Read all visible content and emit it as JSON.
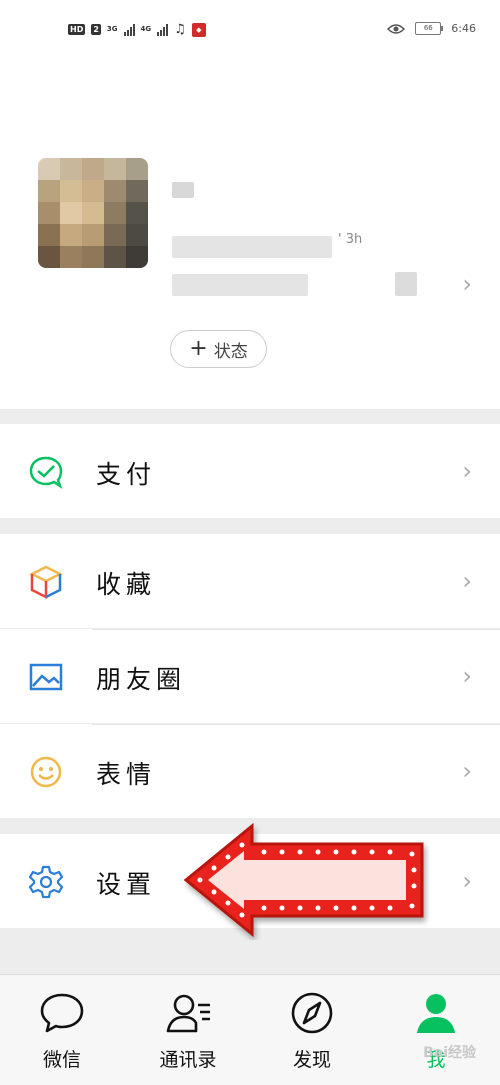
{
  "status_bar": {
    "left_badges": [
      "HD",
      "2"
    ],
    "networks": [
      "3G",
      "4G"
    ],
    "time": "6:46",
    "battery": "66"
  },
  "profile": {
    "id_fragment": "' 3h",
    "status_button": "状态",
    "status_plus": "+"
  },
  "menu": {
    "pay": "支付",
    "favorites": "收藏",
    "moments": "朋友圈",
    "stickers": "表情",
    "settings": "设置"
  },
  "tabs": [
    {
      "label": "微信",
      "icon": "chat-bubble-icon"
    },
    {
      "label": "通讯录",
      "icon": "contacts-icon"
    },
    {
      "label": "发现",
      "icon": "compass-icon"
    },
    {
      "label": "我",
      "icon": "person-icon"
    }
  ],
  "watermark": "Bai经验",
  "colors": {
    "accent": "#07c160",
    "settings_icon": "#2b7fd6",
    "moments_icon": "#2b7fd6",
    "stickers_icon": "#f0b74a",
    "highlight_arrow": "#e8201c"
  }
}
